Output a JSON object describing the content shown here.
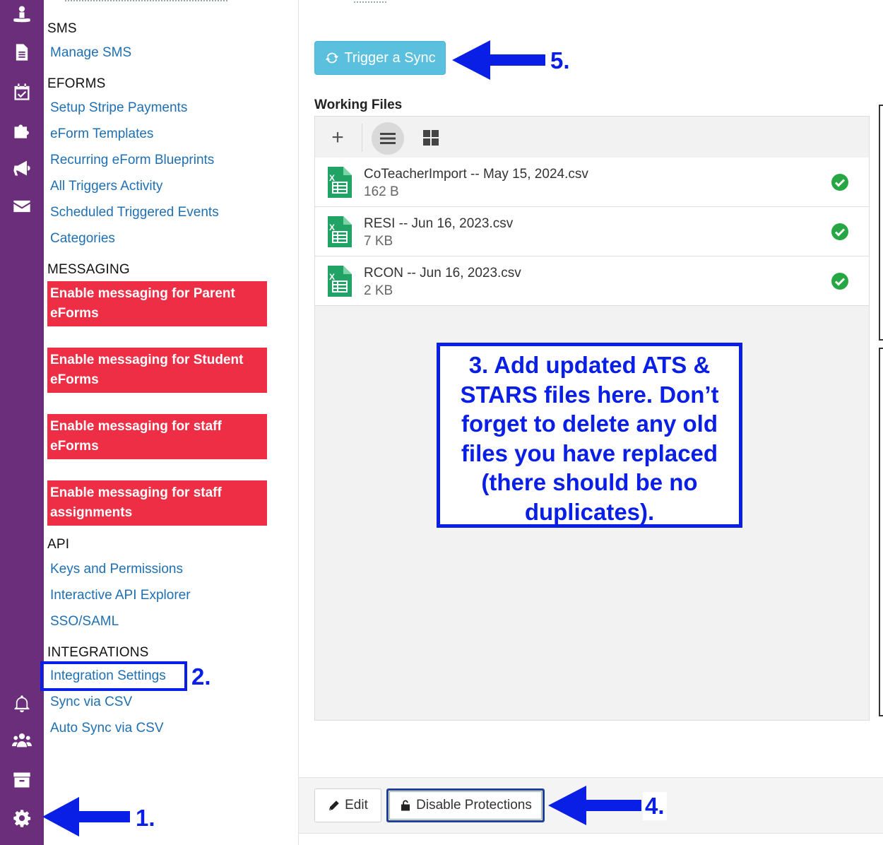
{
  "rail": {
    "icons": [
      "user-pin-icon",
      "document-icon",
      "calendar-check-icon",
      "puzzle-icon",
      "megaphone-icon",
      "envelope-icon",
      "bell-icon",
      "users-icon",
      "archive-icon",
      "gear-icon"
    ]
  },
  "nav": {
    "sms_heading": "SMS",
    "manage_sms": "Manage SMS",
    "eforms_heading": "EFORMS",
    "eforms_links": [
      "Setup Stripe Payments",
      "eForm Templates",
      "Recurring eForm Blueprints",
      "All Triggers Activity",
      "Scheduled Triggered Events",
      "Categories"
    ],
    "messaging_heading": "MESSAGING",
    "messaging_buttons": [
      "Enable messaging for Parent eForms",
      "Enable messaging for Student eForms",
      "Enable messaging for staff eForms",
      "Enable messaging for staff assignments"
    ],
    "api_heading": "API",
    "api_links": [
      "Keys and Permissions",
      "Interactive API Explorer",
      "SSO/SAML"
    ],
    "integrations_heading": "INTEGRATIONS",
    "integrations_links": [
      "Integration Settings",
      "Sync via CSV",
      "Auto Sync via CSV"
    ]
  },
  "main": {
    "sync_button": "Trigger a Sync",
    "working_files_title": "Working Files",
    "files": [
      {
        "name": "CoTeacherImport -- May 15, 2024.csv",
        "size": "162 B"
      },
      {
        "name": "RESI -- Jun 16, 2023.csv",
        "size": "7 KB"
      },
      {
        "name": "RCON -- Jun 16, 2023.csv",
        "size": "2 KB"
      }
    ],
    "callout": "3. Add updated ATS & STARS files here. Don’t forget to delete any old files you have replaced (there should be no duplicates).",
    "edit_button": "Edit",
    "disable_button": "Disable Protections"
  },
  "annotations": {
    "step1": "1.",
    "step2": "2.",
    "step4": "4.",
    "step5": "5."
  },
  "colors": {
    "rail": "#6b2e7a",
    "link": "#1f6fb2",
    "danger": "#ee2e45",
    "sync": "#5bc0de",
    "annotation": "#0a1fe6",
    "success": "#27a744",
    "excel": "#21a366"
  }
}
